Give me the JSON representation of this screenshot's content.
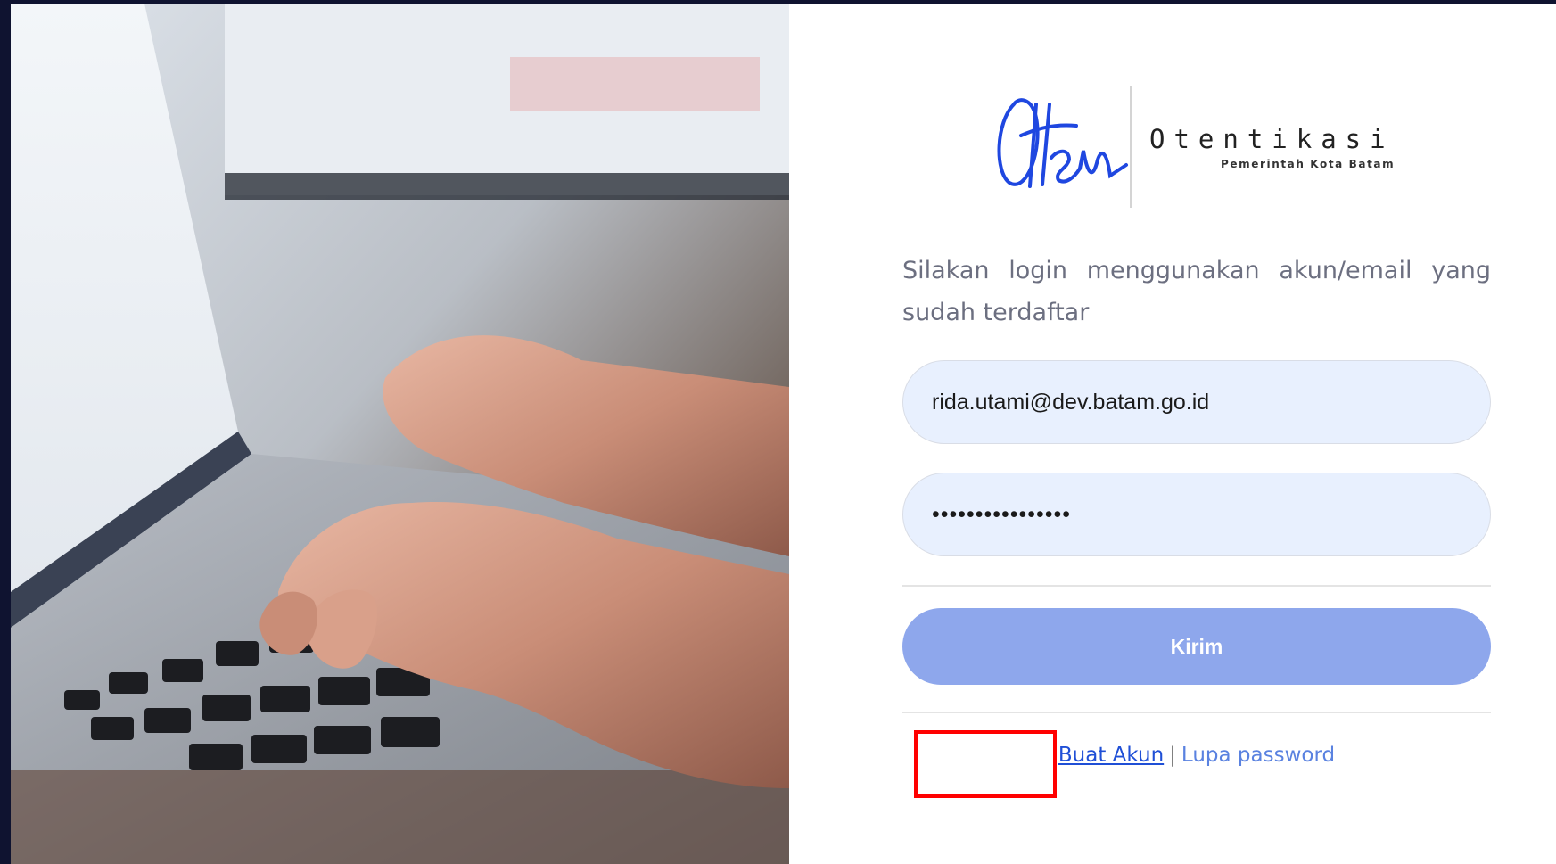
{
  "logo": {
    "script_text": "Oten",
    "title": "Otentikasi",
    "subtitle": "Pemerintah Kota Batam"
  },
  "instruction": "Silakan login menggunakan akun/email yang sudah terdaftar",
  "form": {
    "email_value": "rida.utami@dev.batam.go.id",
    "password_value": "••••••••••••••••",
    "submit_label": "Kirim"
  },
  "links": {
    "create_account": "Buat Akun",
    "separator": "|",
    "forgot_password": "Lupa password"
  },
  "colors": {
    "submit_button": "#8ea7ec",
    "input_background": "#e8f0fe",
    "highlight": "#ff0000",
    "link": "#1f4fd6"
  }
}
